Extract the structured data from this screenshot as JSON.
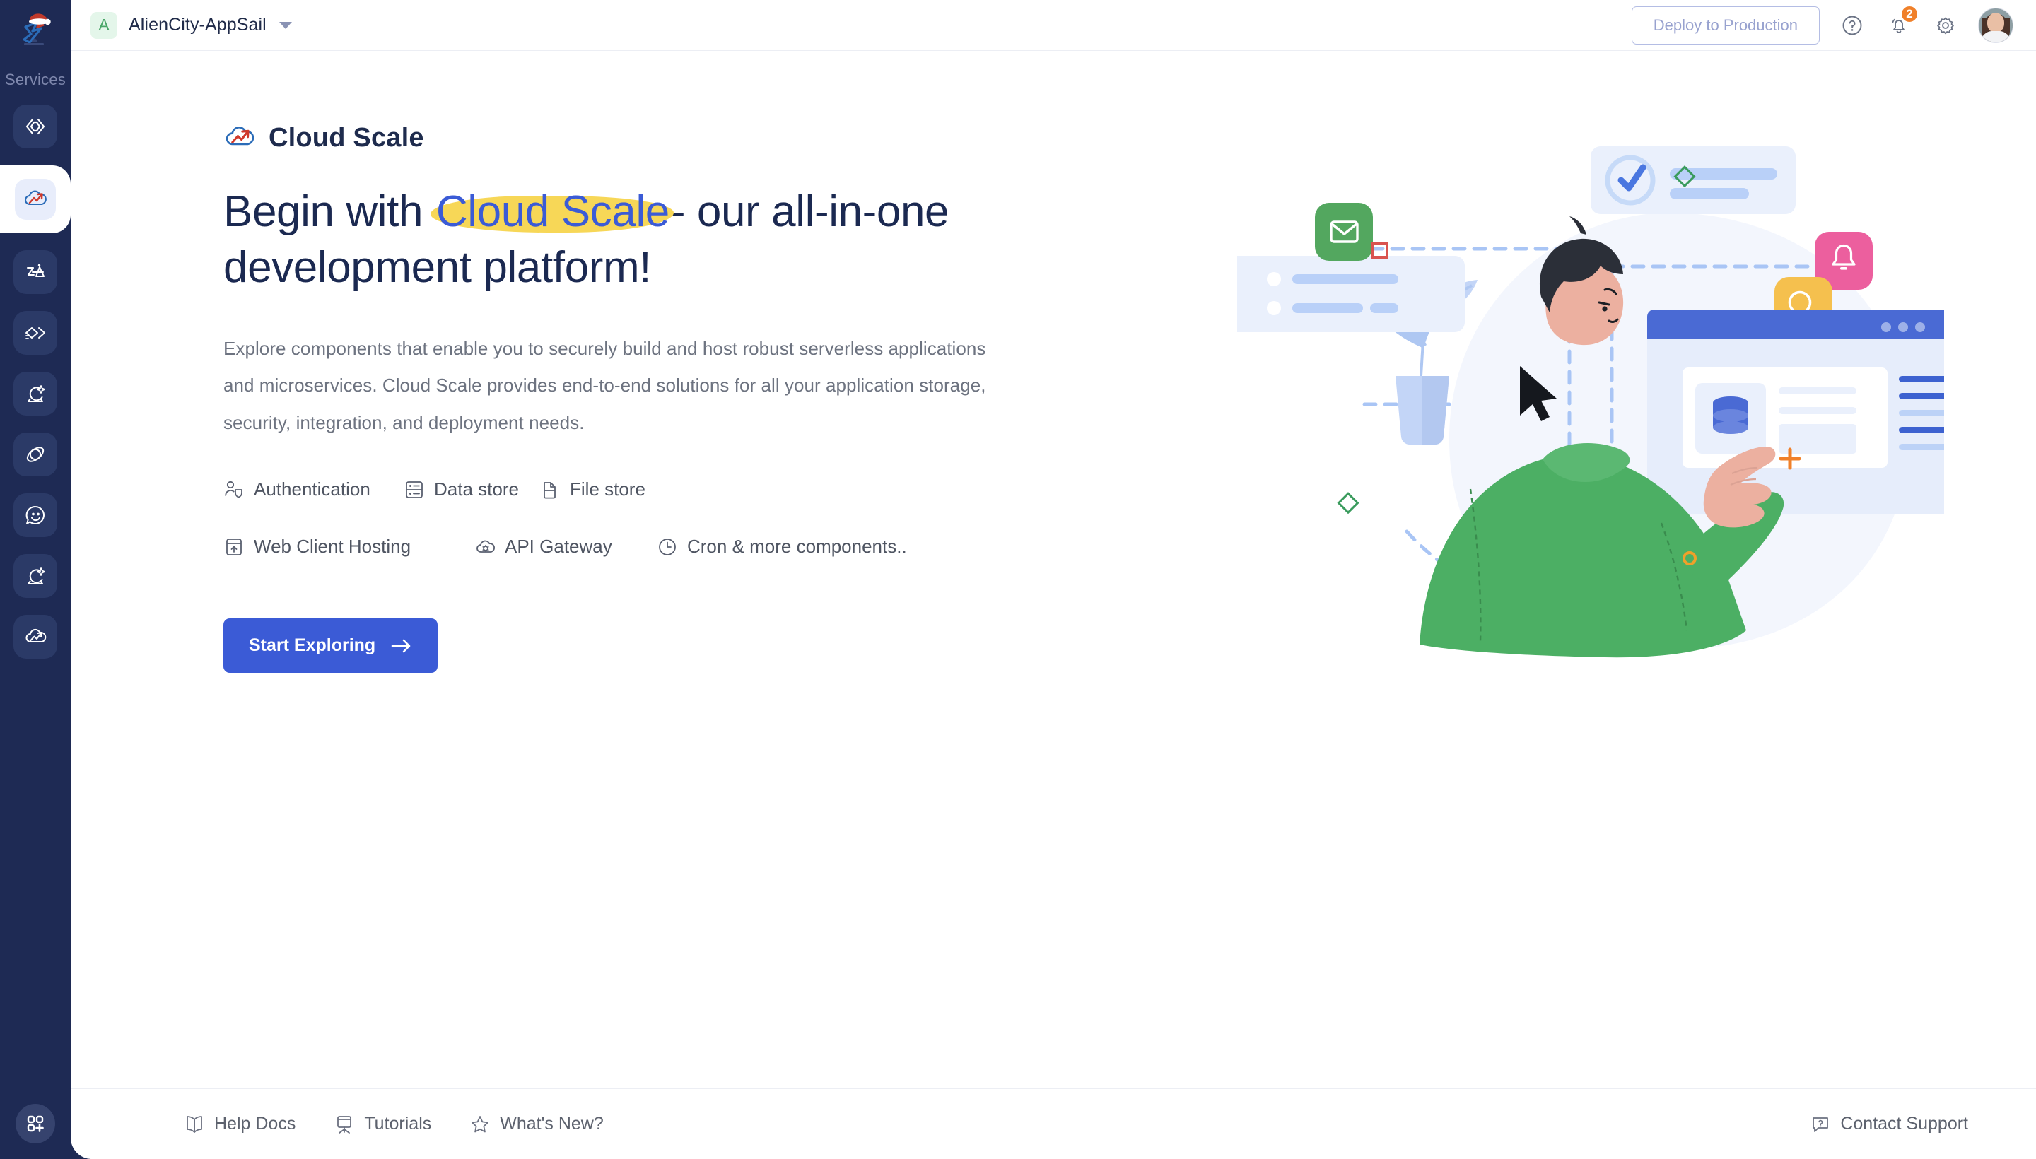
{
  "sidebar": {
    "logo": {
      "icon": "catalyst-logo-santa-hat"
    },
    "section_label": "Services",
    "items": [
      {
        "icon": "code-brackets-icon",
        "active": false
      },
      {
        "icon": "cloud-scale-icon",
        "active": true
      },
      {
        "icon": "zia-ai-icon",
        "active": false
      },
      {
        "icon": "quickml-icon",
        "active": false
      },
      {
        "icon": "crystal-ball-icon",
        "active": false
      },
      {
        "icon": "orbit-icon",
        "active": false
      },
      {
        "icon": "chat-smiley-icon",
        "active": false
      },
      {
        "icon": "crystal-ball-icon-2",
        "active": false
      },
      {
        "icon": "cloud-growth-icon",
        "active": false
      }
    ],
    "apps_button": {
      "icon": "apps-grid-plus-icon"
    }
  },
  "header": {
    "project": {
      "initial": "A",
      "name": "AlienCity-AppSail",
      "caret": "chevron-down-icon"
    },
    "deploy_label": "Deploy to Production",
    "help": {
      "icon": "help-circle-icon"
    },
    "notifications": {
      "icon": "bell-icon",
      "count": "2"
    },
    "settings": {
      "icon": "gear-icon"
    },
    "avatar": {
      "icon": "user-avatar"
    }
  },
  "hero": {
    "brand": {
      "icon": "cloud-scale-icon",
      "title": "Cloud Scale"
    },
    "headline": {
      "before": "Begin with ",
      "highlight": "Cloud Scale",
      "after": "- our all-in-one development platform!"
    },
    "body": "Explore components that enable you to securely build and host robust serverless applications and microservices. Cloud Scale provides end-to-end solutions for all your application storage, security, integration, and deployment needs.",
    "features_row1": [
      {
        "label": "Authentication",
        "icon": "user-shield-icon"
      },
      {
        "label": "Data store",
        "icon": "database-rows-icon"
      },
      {
        "label": "File store",
        "icon": "file-store-icon"
      }
    ],
    "features_row2": [
      {
        "label": "Web Client Hosting",
        "icon": "web-hosting-upload-icon"
      },
      {
        "label": "API Gateway",
        "icon": "api-gateway-cloud-icon"
      },
      {
        "label": "Cron & more components..",
        "icon": "clock-icon"
      }
    ],
    "cta_label": "Start Exploring",
    "cta_icon": "arrow-right-icon"
  },
  "footer": {
    "links": [
      {
        "label": "Help Docs",
        "icon": "book-icon"
      },
      {
        "label": "Tutorials",
        "icon": "easel-icon"
      },
      {
        "label": "What's New?",
        "icon": "star-icon"
      }
    ],
    "support": {
      "label": "Contact Support",
      "icon": "question-chat-icon"
    }
  },
  "colors": {
    "sidebar_bg": "#1e2a54",
    "accent_blue": "#3b5bd6",
    "highlight_yellow": "#f7d757",
    "badge_orange": "#f0802a",
    "heading_navy": "#1b2951",
    "body_gray": "#6d7380",
    "green": "#4caf64",
    "pink": "#ec5f9e",
    "amber": "#f5c04e"
  }
}
